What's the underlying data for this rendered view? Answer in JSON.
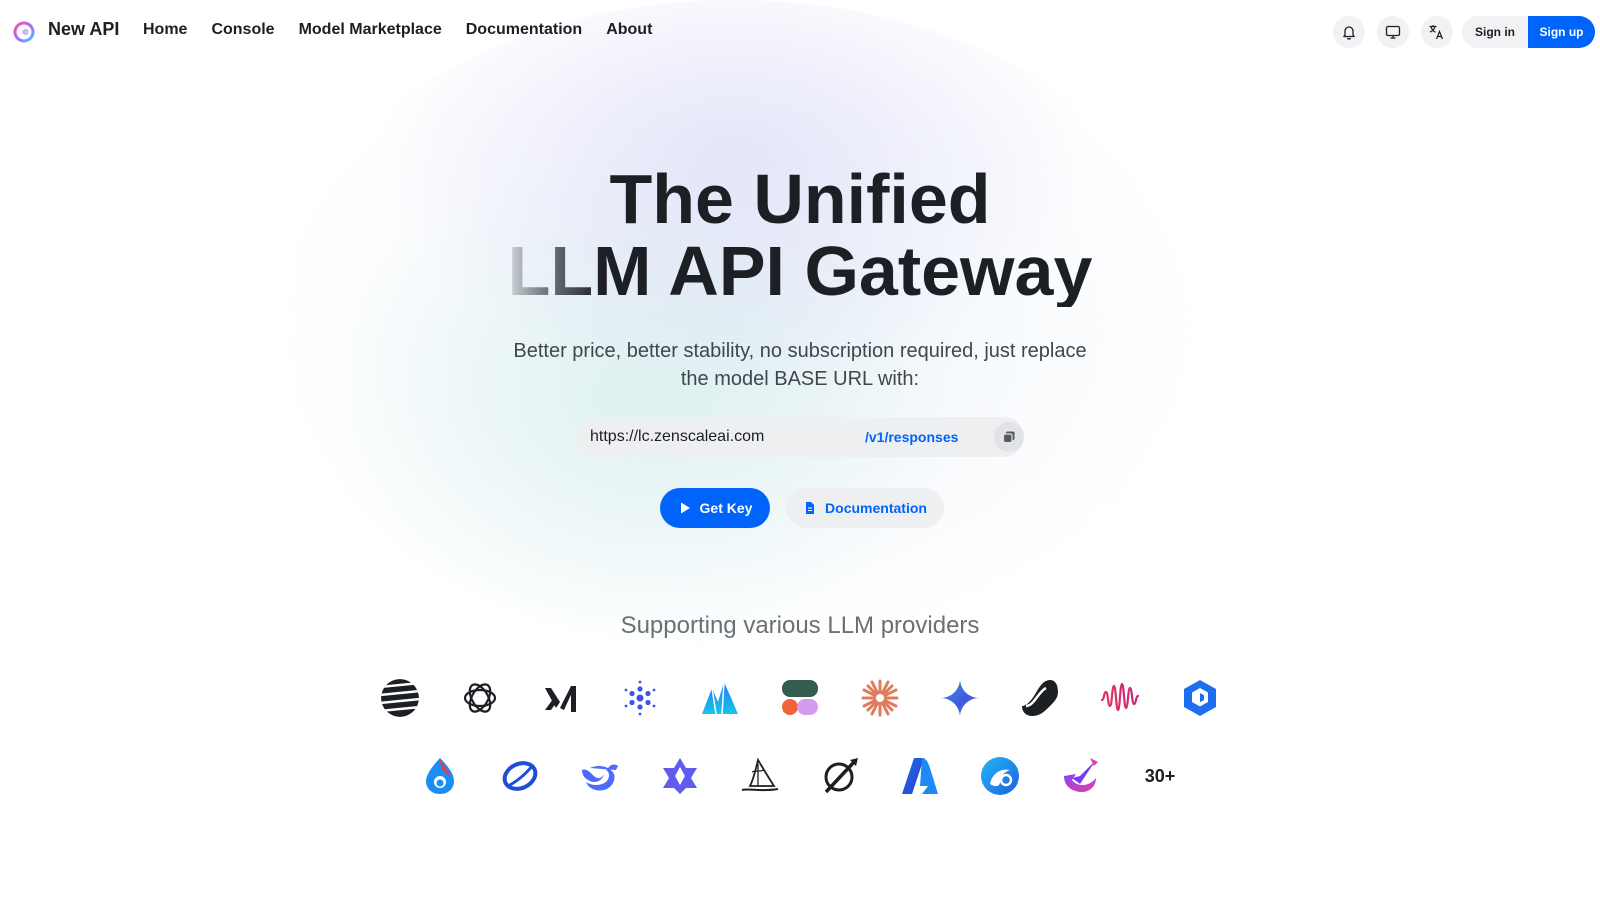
{
  "nav": {
    "brand": "New API",
    "links": [
      "Home",
      "Console",
      "Model Marketplace",
      "Documentation",
      "About"
    ],
    "sign_in": "Sign in",
    "sign_up": "Sign up"
  },
  "hero": {
    "title_line1": "The Unified",
    "title_line2": "LLM API Gateway",
    "subtitle": "Better price, better stability, no subscription required, just replace the model BASE URL with:",
    "base_url": "https://lc.zenscaleai.com",
    "url_path": "/v1/responses",
    "get_key": "Get Key",
    "documentation": "Documentation"
  },
  "providers": {
    "title": "Supporting various LLM providers",
    "row1": [
      "moonshot-icon",
      "openai-icon",
      "xai-icon",
      "dots-icon",
      "mountain-icon",
      "mixed-blocks-icon",
      "claude-icon",
      "gemini-icon",
      "wave-s-icon",
      "audio-wave-icon",
      "hexagon-cube-icon"
    ],
    "row2": [
      "flame-drop-icon",
      "ring-icon",
      "deepseek-whale-icon",
      "qwen-star-icon",
      "midjourney-sail-icon",
      "grok-slash-icon",
      "azure-icon",
      "swirl-icon",
      "check-arc-icon"
    ],
    "more": "30+"
  },
  "colors": {
    "accent": "#0064fa",
    "text": "#1c1f23",
    "muted": "#6b7075"
  }
}
